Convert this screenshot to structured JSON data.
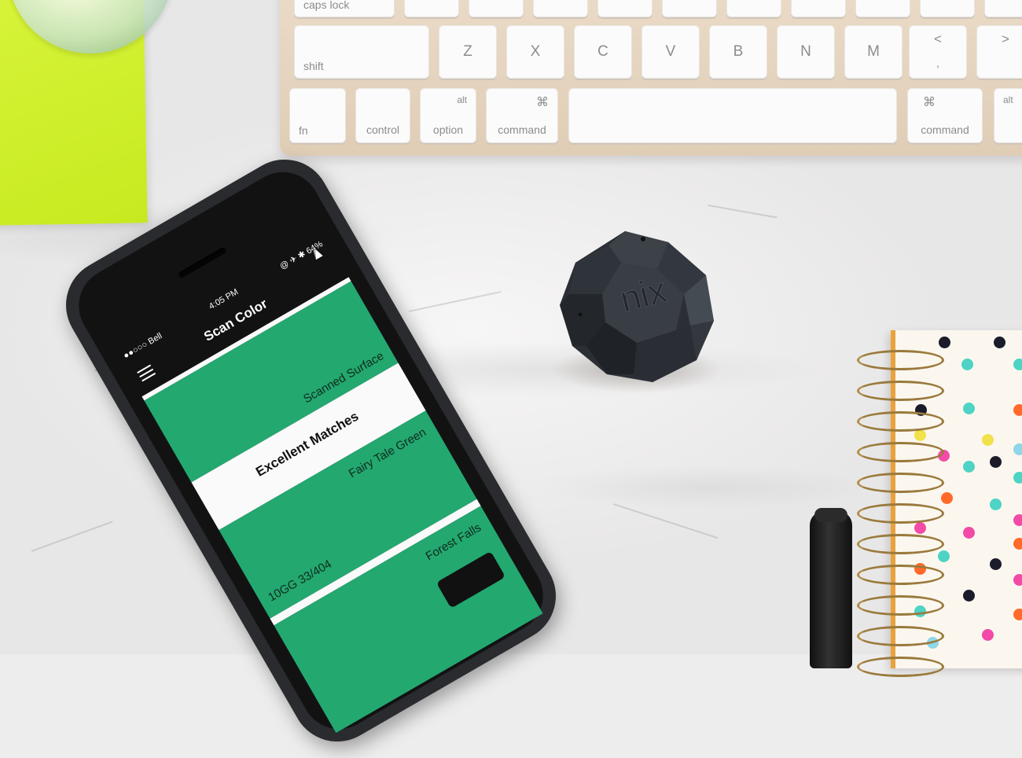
{
  "keyboard": {
    "row_top": [
      {
        "label": "caps lock"
      },
      {
        "label": ""
      },
      {
        "label": ""
      },
      {
        "label": ""
      },
      {
        "label": ""
      },
      {
        "label": ""
      },
      {
        "label": ""
      },
      {
        "label": ""
      },
      {
        "label": ""
      },
      {
        "label": ""
      },
      {
        "label": ""
      }
    ],
    "shift": "shift",
    "letters": [
      "Z",
      "X",
      "C",
      "V",
      "B",
      "N",
      "M"
    ],
    "comma_top": "<",
    "comma_bottom": ",",
    "period_top": ">",
    "fn": "fn",
    "control": "control",
    "option_top": "alt",
    "option": "option",
    "command_symbol": "⌘",
    "command": "command",
    "command_right_symbol": "⌘",
    "command_right": "command",
    "alt_right": "alt"
  },
  "device": {
    "logo": "nix"
  },
  "phone": {
    "carrier": "●●○○○ Bell",
    "time": "4:05 PM",
    "battery": "@ ✈ ✱ 64%",
    "screen_title": "Scan Color",
    "scanned_label": "Scanned Surface",
    "matches_title": "Excellent Matches",
    "match1_name": "Fairy Tale Green",
    "match1_code": "10GG 33/404",
    "match2_name": "Forest Falls",
    "colors": {
      "swatch": "#23a870",
      "panel": "#fafafa",
      "bar": "#121213"
    }
  },
  "notebook": {
    "dot_colors": [
      "#1b1b2a",
      "#4ed3c4",
      "#f1e14a",
      "#f34aa8",
      "#ff6a2a",
      "#8fd6e8"
    ]
  }
}
